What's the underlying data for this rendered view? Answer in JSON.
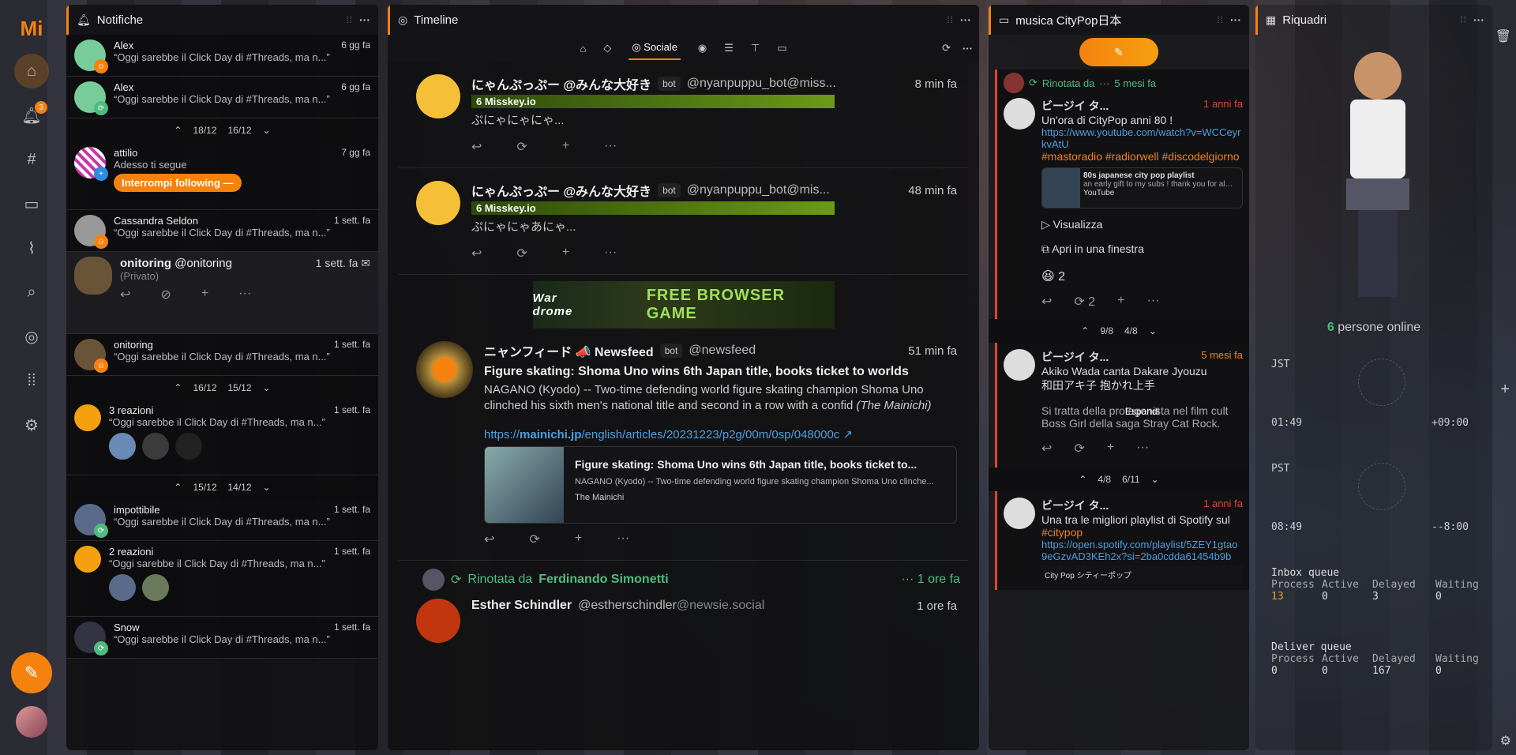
{
  "nav": {
    "logo": "Mi",
    "notif_badge": "3"
  },
  "columns": {
    "notifications": {
      "title": "Notifiche"
    },
    "timeline": {
      "title": "Timeline",
      "tab_selected": "Sociale"
    },
    "citypop": {
      "title": "musica CityPop日本"
    },
    "widgets": {
      "title": "Riquadri"
    }
  },
  "notifs": [
    {
      "name": "Alex",
      "time": "6 gg fa",
      "text": "“Oggi sarebbe il Click Day di #Threads, ma n...”"
    },
    {
      "name": "Alex",
      "time": "6 gg fa",
      "text": "“Oggi sarebbe il Click Day di #Threads, ma n...”"
    },
    {
      "name": "attilio",
      "time": "7 gg fa",
      "text": "Adesso ti segue",
      "button": "Interrompi following"
    },
    {
      "name": "Cassandra Seldon",
      "time": "1 sett. fa",
      "text": "“Oggi sarebbe il Click Day di #Threads, ma n...”"
    },
    {
      "name": "onitoring",
      "user": "@onitoring",
      "time": "1 sett. fa",
      "text": "(Privato)"
    },
    {
      "name": "onitoring",
      "time": "1 sett. fa",
      "text": "“Oggi sarebbe il Click Day di #Threads, ma n...”"
    },
    {
      "name": "3 reazioni",
      "time": "1 sett. fa",
      "text": "“Oggi sarebbe il Click Day di #Threads, ma n...”"
    },
    {
      "name": "impottibile",
      "time": "1 sett. fa",
      "text": "“Oggi sarebbe il Click Day di #Threads, ma n...”"
    },
    {
      "name": "2 reazioni",
      "time": "1 sett. fa",
      "text": "“Oggi sarebbe il Click Day di #Threads, ma n...”"
    },
    {
      "name": "Snow",
      "time": "1 sett. fa",
      "text": "“Oggi sarebbe il Click Day di #Threads, ma n...”"
    }
  ],
  "seps": [
    {
      "a": "18/12",
      "b": "16/12"
    },
    {
      "a": "16/12",
      "b": "15/12"
    },
    {
      "a": "15/12",
      "b": "14/12"
    }
  ],
  "notes": [
    {
      "name": "にゃんぷっぷー @みんな大好き",
      "bot": "bot",
      "user": "@nyanpuppu_bot@miss...",
      "time": "8 min fa",
      "instance": "Misskey.io",
      "text": "ぷにゃにゃにゃ..."
    },
    {
      "name": "にゃんぷっぷー @みんな大好き",
      "bot": "bot",
      "user": "@nyanpuppu_bot@mis...",
      "time": "48 min fa",
      "instance": "Misskey.io",
      "text": "ぷにゃにゃあにゃ..."
    }
  ],
  "ad": {
    "text": "FREE BROWSER GAME",
    "brand": "War drome"
  },
  "news": {
    "name": "ニャンフィード 📣 Newsfeed",
    "bot": "bot",
    "user": "@newsfeed",
    "time": "51 min fa",
    "title": "Figure skating: Shoma Uno wins 6th Japan title, books ticket to worlds",
    "body": "NAGANO (Kyodo) -- Two-time defending world figure skating champion Shoma Uno clinched his sixth men's national title and second in a row with a confid",
    "source": "(The Mainichi)",
    "link_pre": "https://",
    "link_host": "mainichi.jp",
    "link_path": "/english/articles/20231223/p2g/00m/0sp/048000c",
    "card_title": "Figure skating: Shoma Uno wins 6th Japan title, books ticket to...",
    "card_desc": "NAGANO (Kyodo) -- Two-time defending world figure skating champion Shoma Uno clinche...",
    "card_site": "The Mainichi"
  },
  "renote": {
    "label": "Rinotata da",
    "by": "Ferdinando Simonetti",
    "time": "1 ore fa"
  },
  "esther": {
    "name": "Esther Schindler",
    "user": "@estherschindler",
    "host": "@newsie.social",
    "time": "1 ore fa"
  },
  "cp": {
    "renote_label": "Rinotata da",
    "renote_time": "5 mesi fa",
    "n1": {
      "name": "ビージイ タ...",
      "time": "1 anni fa",
      "text": "Un'ora di CityPop anni 80 !",
      "link": "https://www.youtube.com/watch?v=WCCeyrkvAtU",
      "tags": "#mastoradio #radiorwell #discodelgiorno",
      "card_title": "80s japanese city pop playlist",
      "card_desc": "an early gift to my subs ! thank you for almost 80K...",
      "card_site": "YouTube",
      "btn1": "Visualizza",
      "btn2": "Apri in una finestra",
      "react_count": "2",
      "renote_count": "2"
    },
    "sep1": {
      "a": "9/8",
      "b": "4/8"
    },
    "n2": {
      "name": "ビージイ タ...",
      "time": "5 mesi fa",
      "text1": "Akiko Wada canta Dakare Jyouzu",
      "text2": "和田アキ子 抱かれ上手",
      "text3": "Si tratta della protagonista nel film cult Boss Girl della saga Stray Cat Rock.",
      "expand": "Espandi"
    },
    "sep2": {
      "a": "4/8",
      "b": "6/11"
    },
    "n3": {
      "name": "ビージイ タ...",
      "time": "1 anni fa",
      "text": "Una tra le migliori playlist di Spotify sul",
      "tag": "#citypop",
      "link": "https://open.spotify.com/playlist/5ZEY1gtao9eGzvAD3KEh2x?si=2ba0cdda61454b9b",
      "card": "City Pop シティーポップ"
    }
  },
  "widgets": {
    "online_count": "6",
    "online_label": "persone online",
    "clock1": {
      "tz": "JST",
      "time": "01:49",
      "offset": "+09:00"
    },
    "clock2": {
      "tz": "PST",
      "time": "08:49",
      "offset": "--8:00"
    },
    "inbox": {
      "title": "Inbox queue",
      "h": [
        "Process",
        "Active",
        "Delayed",
        "Waiting"
      ],
      "v": [
        "13",
        "0",
        "3",
        "0"
      ]
    },
    "deliver": {
      "title": "Deliver queue",
      "h": [
        "Process",
        "Active",
        "Delayed",
        "Waiting"
      ],
      "v": [
        "0",
        "0",
        "167",
        "0"
      ]
    }
  },
  "colors": {
    "accent": "#f5820f",
    "renote": "#4ebc7e",
    "link": "#4a9fe0"
  }
}
